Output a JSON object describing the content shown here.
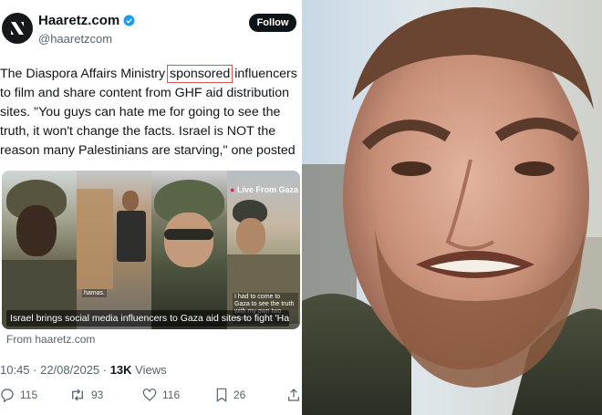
{
  "tweet": {
    "display_name": "Haaretz.com",
    "handle": "@haaretzcom",
    "follow_label": "Follow",
    "text_lines": [
      "The Diaspora Affairs Ministry",
      "sponsored",
      "influencers",
      "to film and share content from GHF aid distribution",
      "sites. \"You guys can hate me for going to see the",
      "truth, it won't change the facts. Israel is NOT the",
      "reason many Palestinians are starving,\" one posted"
    ],
    "card": {
      "caption": "Israel brings social media influencers to Gaza aid sites to fight 'Ham...",
      "live_label": "Live From Gaza",
      "overlay_hamas": "hamas.",
      "overlay_quote": "I had to come to Gaza to see the truth with my own two eyes."
    },
    "from_label": "From haaretz.com",
    "time": "10:45 · 22/08/2025 · ",
    "views_count": "13K",
    "views_label": " Views",
    "stats": {
      "replies": "115",
      "reposts": "93",
      "likes": "116",
      "bookmarks": "26"
    }
  },
  "colors": {
    "highlight_box": "#d9534f",
    "verified": "#1d9bf0",
    "text_primary": "#0f1419",
    "text_secondary": "#536471"
  }
}
